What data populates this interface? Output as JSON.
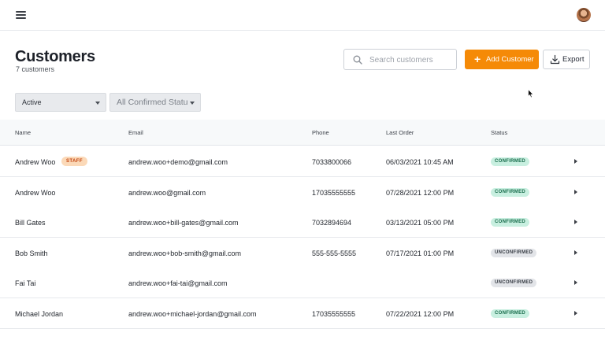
{
  "header": {
    "menu_icon": "hamburger-menu-icon",
    "avatar_icon": "user-avatar"
  },
  "page": {
    "title": "Customers",
    "subtitle": "7 customers"
  },
  "search": {
    "placeholder": "Search customers",
    "icon": "search-icon"
  },
  "actions": {
    "add_label": "Add Customer",
    "add_icon": "plus-icon",
    "export_label": "Export",
    "export_icon": "download-icon",
    "accent": "#f58a07"
  },
  "filters": {
    "status": "Active",
    "confirmation": "All Confirmed Statu"
  },
  "table": {
    "columns": {
      "name": "Name",
      "email": "Email",
      "phone": "Phone",
      "last_order": "Last Order",
      "status": "Status"
    },
    "rows": [
      {
        "name": "Andrew Woo",
        "tag": "STAFF",
        "email": "andrew.woo+demo@gmail.com",
        "phone": "7033800066",
        "last_order": "06/03/2021 10:45 AM",
        "status": "CONFIRMED"
      },
      {
        "name": "Andrew Woo",
        "tag": "",
        "email": "andrew.woo@gmail.com",
        "phone": "17035555555",
        "last_order": "07/28/2021 12:00 PM",
        "status": "CONFIRMED"
      },
      {
        "name": "Bill Gates",
        "tag": "",
        "email": "andrew.woo+bill-gates@gmail.com",
        "phone": "7032894694",
        "last_order": "03/13/2021 05:00 PM",
        "status": "CONFIRMED"
      },
      {
        "name": "Bob Smith",
        "tag": "",
        "email": "andrew.woo+bob-smith@gmail.com",
        "phone": "555-555-5555",
        "last_order": "07/17/2021 01:00 PM",
        "status": "UNCONFIRMED"
      },
      {
        "name": "Fai Tai",
        "tag": "",
        "email": "andrew.woo+fai-tai@gmail.com",
        "phone": "",
        "last_order": "",
        "status": "UNCONFIRMED"
      },
      {
        "name": "Michael Jordan",
        "tag": "",
        "email": "andrew.woo+michael-jordan@gmail.com",
        "phone": "17035555555",
        "last_order": "07/22/2021 12:00 PM",
        "status": "CONFIRMED"
      }
    ]
  },
  "status_colors": {
    "CONFIRMED": {
      "bg": "#c8efe0",
      "fg": "#166b4a"
    },
    "UNCONFIRMED": {
      "bg": "#e2e4e8",
      "fg": "#3a3f47"
    }
  }
}
